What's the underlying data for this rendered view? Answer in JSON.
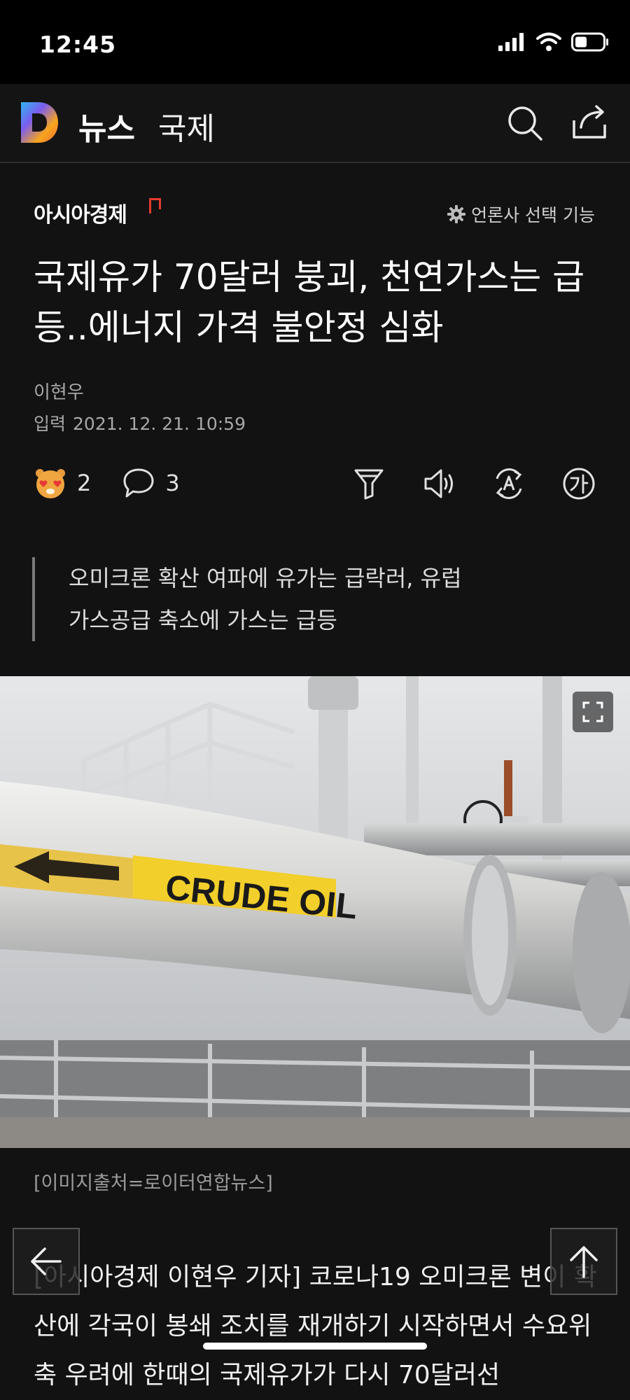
{
  "status": {
    "time": "12:45"
  },
  "appbar": {
    "title": "뉴스",
    "section": "국제"
  },
  "publisher": {
    "name": "아시아경제",
    "select_label": "언론사 선택 기능"
  },
  "article": {
    "headline": "국제유가 70달러 붕괴, 천연가스는 급등..에너지 가격 불안정 심화",
    "author": "이현우",
    "date_label": "입력",
    "date": "2021. 12. 21. 10:59",
    "reaction_count": "2",
    "comment_count": "3",
    "summary": "오미크론 확산 여파에 유가는 급락러, 유럽 가스공급 축소에 가스는 급등",
    "image_text": "CRUDE OIL",
    "caption": "[이미지출처=로이터연합뉴스]",
    "body": "[아시아경제 이현우 기자] 코로나19 오미크론 변이 확산에 각국이 봉쇄 조치를 재개하기 시작하면서 수요위축 우려에 한때의 국제유가가 다시 70달러선"
  },
  "colors": {
    "accent_red": "#e53b2f",
    "logo_orange": "#f6a623",
    "logo_purple": "#6c5ce7"
  }
}
